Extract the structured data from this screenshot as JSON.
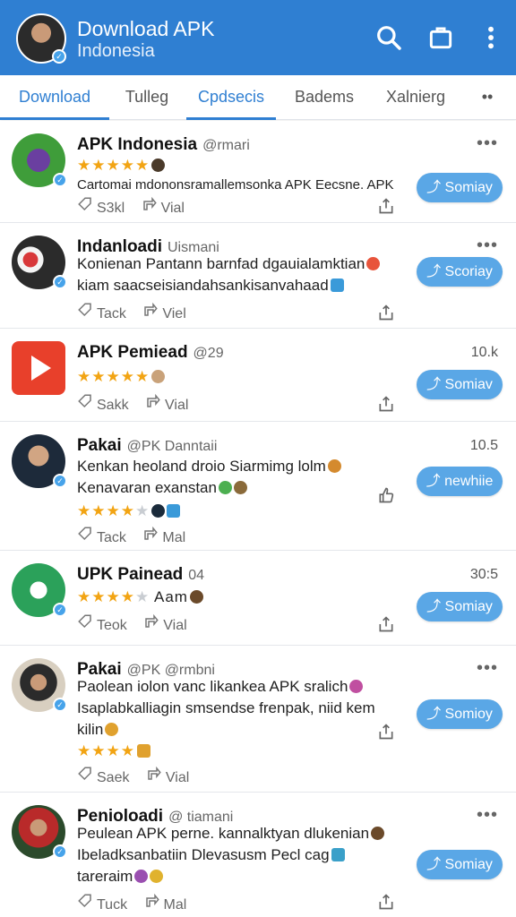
{
  "appbar": {
    "title": "Download APK",
    "subtitle": "Indonesia"
  },
  "tabs": [
    {
      "label": "Download"
    },
    {
      "label": "Tulleg"
    },
    {
      "label": "Cpdsecis"
    },
    {
      "label": "Badems"
    },
    {
      "label": "Xalnierg"
    },
    {
      "label": "••"
    }
  ],
  "posts": [
    {
      "name": "APK Indonesia",
      "handle": "@rmari",
      "meta": "•••",
      "text1": "Cartomai mdononsramallemsonka APK Eecsne. APK",
      "text2": "",
      "stars": "★★★★★",
      "stars_grey": "",
      "stars_extra": "",
      "action1": "S3kl",
      "action2": "Vial",
      "cta": "Somiay"
    },
    {
      "name": "Indanloadi",
      "handle": "Uismani",
      "meta": "•••",
      "text1": "Konienan Pantann barnfad dgauialamktian",
      "text2": "kiam saacseisiandahsankisanvahaad",
      "stars": "",
      "stars_grey": "",
      "stars_extra": "",
      "action1": "Tack",
      "action2": "Viel",
      "cta": "Scoriay"
    },
    {
      "name": "APK Pemiead",
      "handle": "@29",
      "meta": "10.k",
      "text1": "",
      "text2": "",
      "stars": "★★★★★",
      "stars_grey": "",
      "stars_extra": "",
      "action1": "Sakk",
      "action2": "Vial",
      "cta": "Somiav"
    },
    {
      "name": "Pakai",
      "handle": "@PK Danntaii",
      "meta": "10.5",
      "text1": "Kenkan heoland droio Siarmimg lolm",
      "text2": "Kenavaran exanstan",
      "stars": "★★★★",
      "stars_grey": "★",
      "stars_extra": "",
      "action1": "Tack",
      "action2": "Mal",
      "cta": "newhiie"
    },
    {
      "name": "UPK Painead",
      "handle": "04",
      "meta": "30:5",
      "text1": "",
      "text2": "",
      "stars": "★★★★",
      "stars_grey": "★",
      "stars_extra": "Aam",
      "action1": "Teok",
      "action2": "Vial",
      "cta": "Somiay"
    },
    {
      "name": "Pakai",
      "handle": "@PK @rmbni",
      "meta": "•••",
      "text1": "Paolean iolon vanc likankea APK sralich",
      "text2": "Isaplabkalliagin smsendse frenpak, niid kem",
      "text3": "kilin",
      "stars": "★★★★",
      "stars_grey": "",
      "stars_extra": "",
      "action1": "Saek",
      "action2": "Vial",
      "cta": "Somioy"
    },
    {
      "name": "Penioloadi",
      "handle": "@ tiamani",
      "meta": "•••",
      "text1": "Peulean APK perne. kannalktyan dlukenian",
      "text2": "Ibeladksanbatiin Dlevasusm Pecl cag",
      "text3": "tareraim",
      "stars": "",
      "stars_grey": "",
      "stars_extra": "",
      "action1": "Tuck",
      "action2": "Mal",
      "cta": "Somiay"
    }
  ]
}
